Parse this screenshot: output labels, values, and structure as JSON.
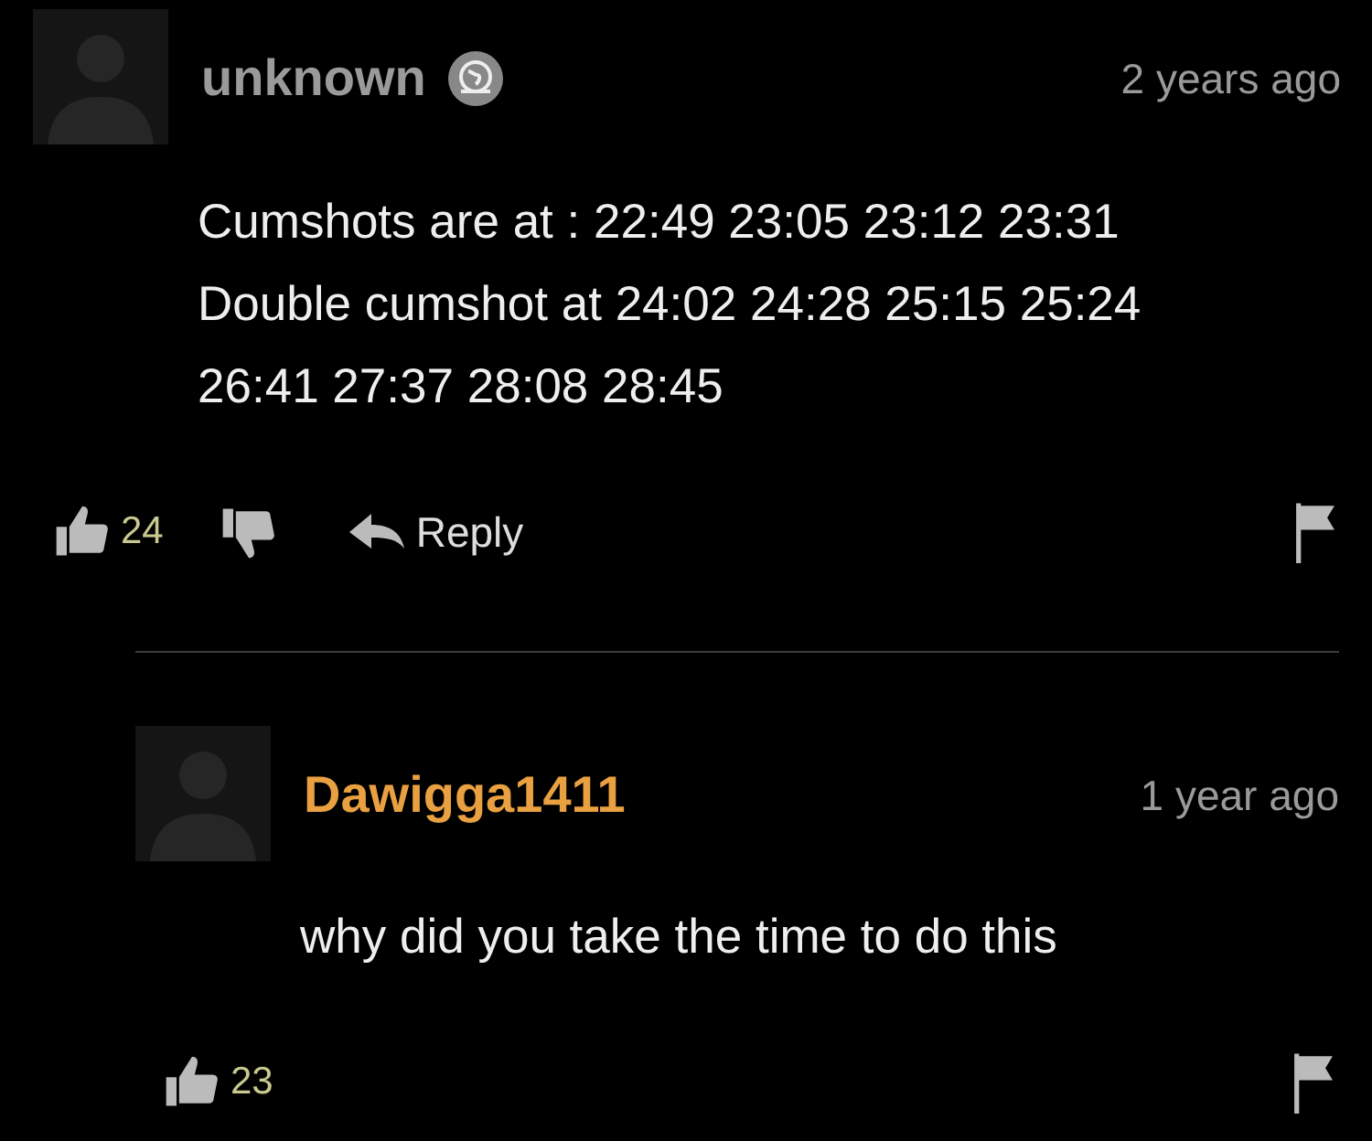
{
  "comments": [
    {
      "author": "unknown",
      "color": "#9a9a9a",
      "badge": true,
      "time": "2 years ago",
      "body": "Cumshots are at : 22:49 23:05 23:12 23:31\nDouble cumshot at 24:02 24:28 25:15 25:24\n26:41 27:37 28:08 28:45",
      "likes": "24",
      "dislike": true,
      "reply": "Reply",
      "reply_to": false
    },
    {
      "author": "Dawigga1411",
      "color": "#e8a040",
      "badge": false,
      "time": "1 year ago",
      "body": "why did you take the time to do this",
      "likes": "23",
      "dislike": false,
      "reply_to": true
    }
  ]
}
